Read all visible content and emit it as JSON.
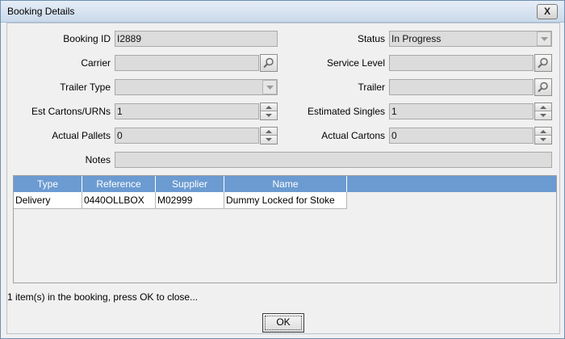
{
  "window": {
    "title": "Booking Details",
    "close_glyph": "X"
  },
  "form": {
    "booking_id": {
      "label": "Booking ID",
      "value": "I2889"
    },
    "status": {
      "label": "Status",
      "value": "In Progress"
    },
    "carrier": {
      "label": "Carrier",
      "value": ""
    },
    "service_level": {
      "label": "Service Level",
      "value": ""
    },
    "trailer_type": {
      "label": "Trailer Type",
      "value": ""
    },
    "trailer": {
      "label": "Trailer",
      "value": ""
    },
    "est_cartons": {
      "label": "Est Cartons/URNs",
      "value": "1"
    },
    "estimated_singles": {
      "label": "Estimated Singles",
      "value": "1"
    },
    "actual_pallets": {
      "label": "Actual Pallets",
      "value": "0"
    },
    "actual_cartons": {
      "label": "Actual Cartons",
      "value": "0"
    },
    "notes": {
      "label": "Notes",
      "value": ""
    }
  },
  "table": {
    "columns": [
      "Type",
      "Reference",
      "Supplier",
      "Name"
    ],
    "rows": [
      [
        "Delivery",
        "0440OLLBOX",
        "M02999",
        "Dummy Locked for Stoke"
      ]
    ]
  },
  "footer": {
    "message": "1 item(s) in the booking, press OK to close...",
    "ok_label": "OK"
  },
  "icons": {
    "lookup": "magnifier-icon",
    "dropdown": "chevron-down-icon",
    "spinner": "spinner-arrows-icon"
  }
}
